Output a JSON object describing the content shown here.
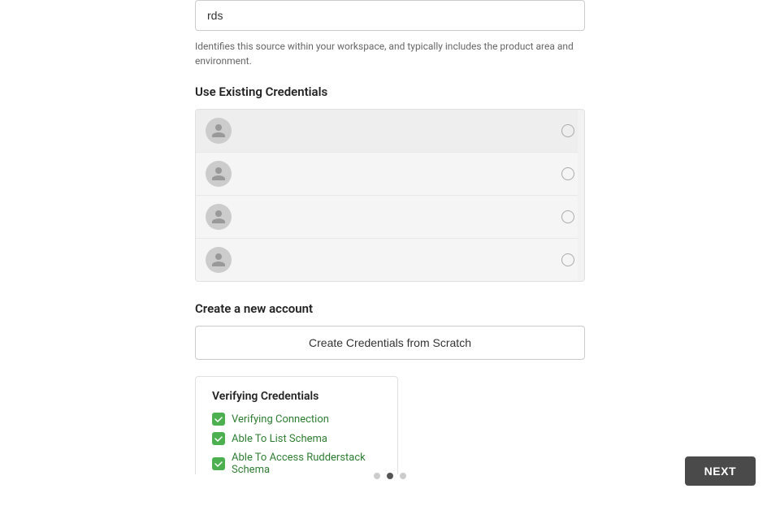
{
  "input": {
    "value": "rds",
    "placeholder": "rds"
  },
  "helper_text": "Identifies this source within your workspace, and typically includes the product area and environment.",
  "use_existing_section": {
    "title": "Use Existing Credentials",
    "credentials": [
      {
        "id": 1,
        "name": ""
      },
      {
        "id": 2,
        "name": ""
      },
      {
        "id": 3,
        "name": ""
      },
      {
        "id": 4,
        "name": ""
      }
    ]
  },
  "new_account_section": {
    "title": "Create a new account",
    "button_label": "Create Credentials from Scratch"
  },
  "verifying_panel": {
    "title": "Verifying Credentials",
    "items": [
      {
        "id": 1,
        "label": "Verifying Connection"
      },
      {
        "id": 2,
        "label": "Able To List Schema"
      },
      {
        "id": 3,
        "label": "Able To Access Rudderstack Schema"
      }
    ]
  },
  "pagination": {
    "dots": [
      {
        "id": 1,
        "active": false
      },
      {
        "id": 2,
        "active": true
      },
      {
        "id": 3,
        "active": false
      }
    ]
  },
  "next_button": {
    "label": "NEXT"
  },
  "icons": {
    "check": "✔",
    "avatar": "person"
  }
}
